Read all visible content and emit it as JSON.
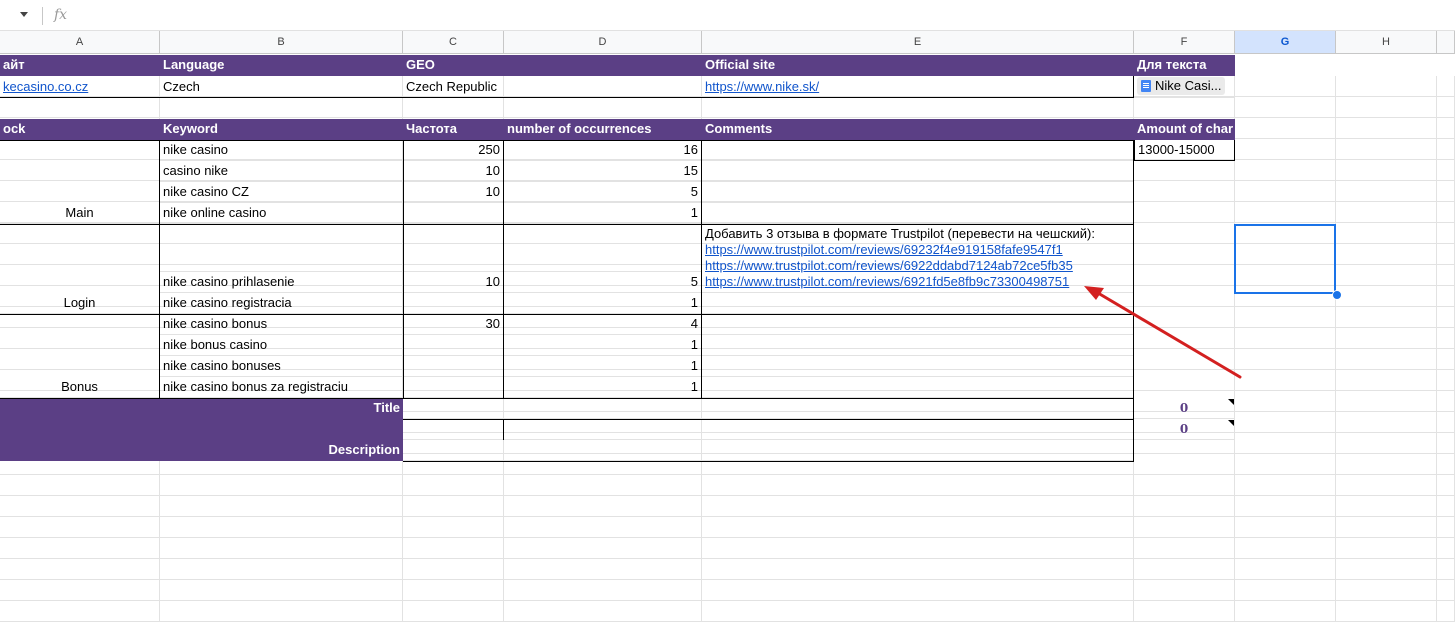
{
  "formula_bar": {
    "fx_label": "fx",
    "content": ""
  },
  "columns": [
    "A",
    "B",
    "C",
    "D",
    "E",
    "F",
    "G",
    "H"
  ],
  "header1": {
    "site": "айт",
    "language": "Language",
    "geo": "GEO",
    "official_site": "Official site",
    "for_text": "Для текста"
  },
  "info_row": {
    "site": "kecasino.co.cz",
    "language": "Czech",
    "geo": "Czech Republic",
    "official_site": "https://www.nike.sk/",
    "doc_chip": "Nike Casi..."
  },
  "header2": {
    "block": "ock",
    "keyword": "Keyword",
    "frequency": "Частота",
    "occurrences": "number of occurrences",
    "comments": "Comments",
    "amount": "Amount of char"
  },
  "amount_value": "13000-15000",
  "blocks": {
    "main": "Main",
    "login": "Login",
    "bonus": "Bonus"
  },
  "rows": [
    {
      "keyword": "nike casino",
      "freq": "250",
      "occ": "16"
    },
    {
      "keyword": "casino nike",
      "freq": "10",
      "occ": "15"
    },
    {
      "keyword": "nike casino CZ",
      "freq": "10",
      "occ": "5"
    },
    {
      "keyword": "nike online casino",
      "freq": "",
      "occ": "1"
    },
    {
      "keyword": "nike casino prihlasenie",
      "freq": "10",
      "occ": "5"
    },
    {
      "keyword": "nike casino registracia",
      "freq": "",
      "occ": "1"
    },
    {
      "keyword": "nike casino bonus",
      "freq": "30",
      "occ": "4"
    },
    {
      "keyword": "nike bonus casino",
      "freq": "",
      "occ": "1"
    },
    {
      "keyword": "nike casino bonuses",
      "freq": "",
      "occ": "1"
    },
    {
      "keyword": "nike casino bonus za registraciu",
      "freq": "",
      "occ": "1"
    }
  ],
  "comment": {
    "text": "Добавить 3 отзыва в формате Trustpilot (перевести на чешский):",
    "links": [
      "https://www.trustpilot.com/reviews/69232f4e919158fafe9547f1",
      "https://www.trustpilot.com/reviews/6922ddabd7124ab72ce5fb35",
      "https://www.trustpilot.com/reviews/6921fd5e8fb9c73300498751"
    ]
  },
  "meta": {
    "title_label": "Title",
    "description_label": "Description",
    "title_count": "0",
    "description_count": "0"
  },
  "colors": {
    "header_purple": "#5b3f85",
    "link_blue": "#1155cc",
    "selection_blue": "#1a73e8",
    "arrow_red": "#d32020"
  }
}
